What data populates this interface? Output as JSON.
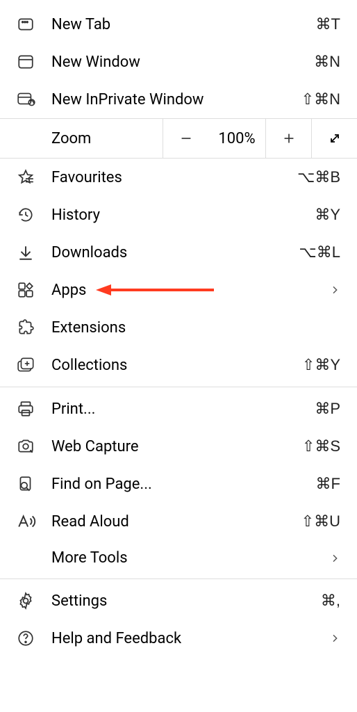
{
  "menu": {
    "new_tab": {
      "label": "New Tab",
      "shortcut": "⌘T"
    },
    "new_window": {
      "label": "New Window",
      "shortcut": "⌘N"
    },
    "new_inprivate": {
      "label": "New InPrivate Window",
      "shortcut": "⇧⌘N"
    },
    "zoom": {
      "label": "Zoom",
      "value": "100%"
    },
    "favourites": {
      "label": "Favourites",
      "shortcut": "⌥⌘B"
    },
    "history": {
      "label": "History",
      "shortcut": "⌘Y"
    },
    "downloads": {
      "label": "Downloads",
      "shortcut": "⌥⌘L"
    },
    "apps": {
      "label": "Apps"
    },
    "extensions": {
      "label": "Extensions"
    },
    "collections": {
      "label": "Collections",
      "shortcut": "⇧⌘Y"
    },
    "print": {
      "label": "Print...",
      "shortcut": "⌘P"
    },
    "web_capture": {
      "label": "Web Capture",
      "shortcut": "⇧⌘S"
    },
    "find": {
      "label": "Find on Page...",
      "shortcut": "⌘F"
    },
    "read_aloud": {
      "label": "Read Aloud",
      "shortcut": "⇧⌘U"
    },
    "more_tools": {
      "label": "More Tools"
    },
    "settings": {
      "label": "Settings",
      "shortcut": "⌘,"
    },
    "help": {
      "label": "Help and Feedback"
    }
  }
}
